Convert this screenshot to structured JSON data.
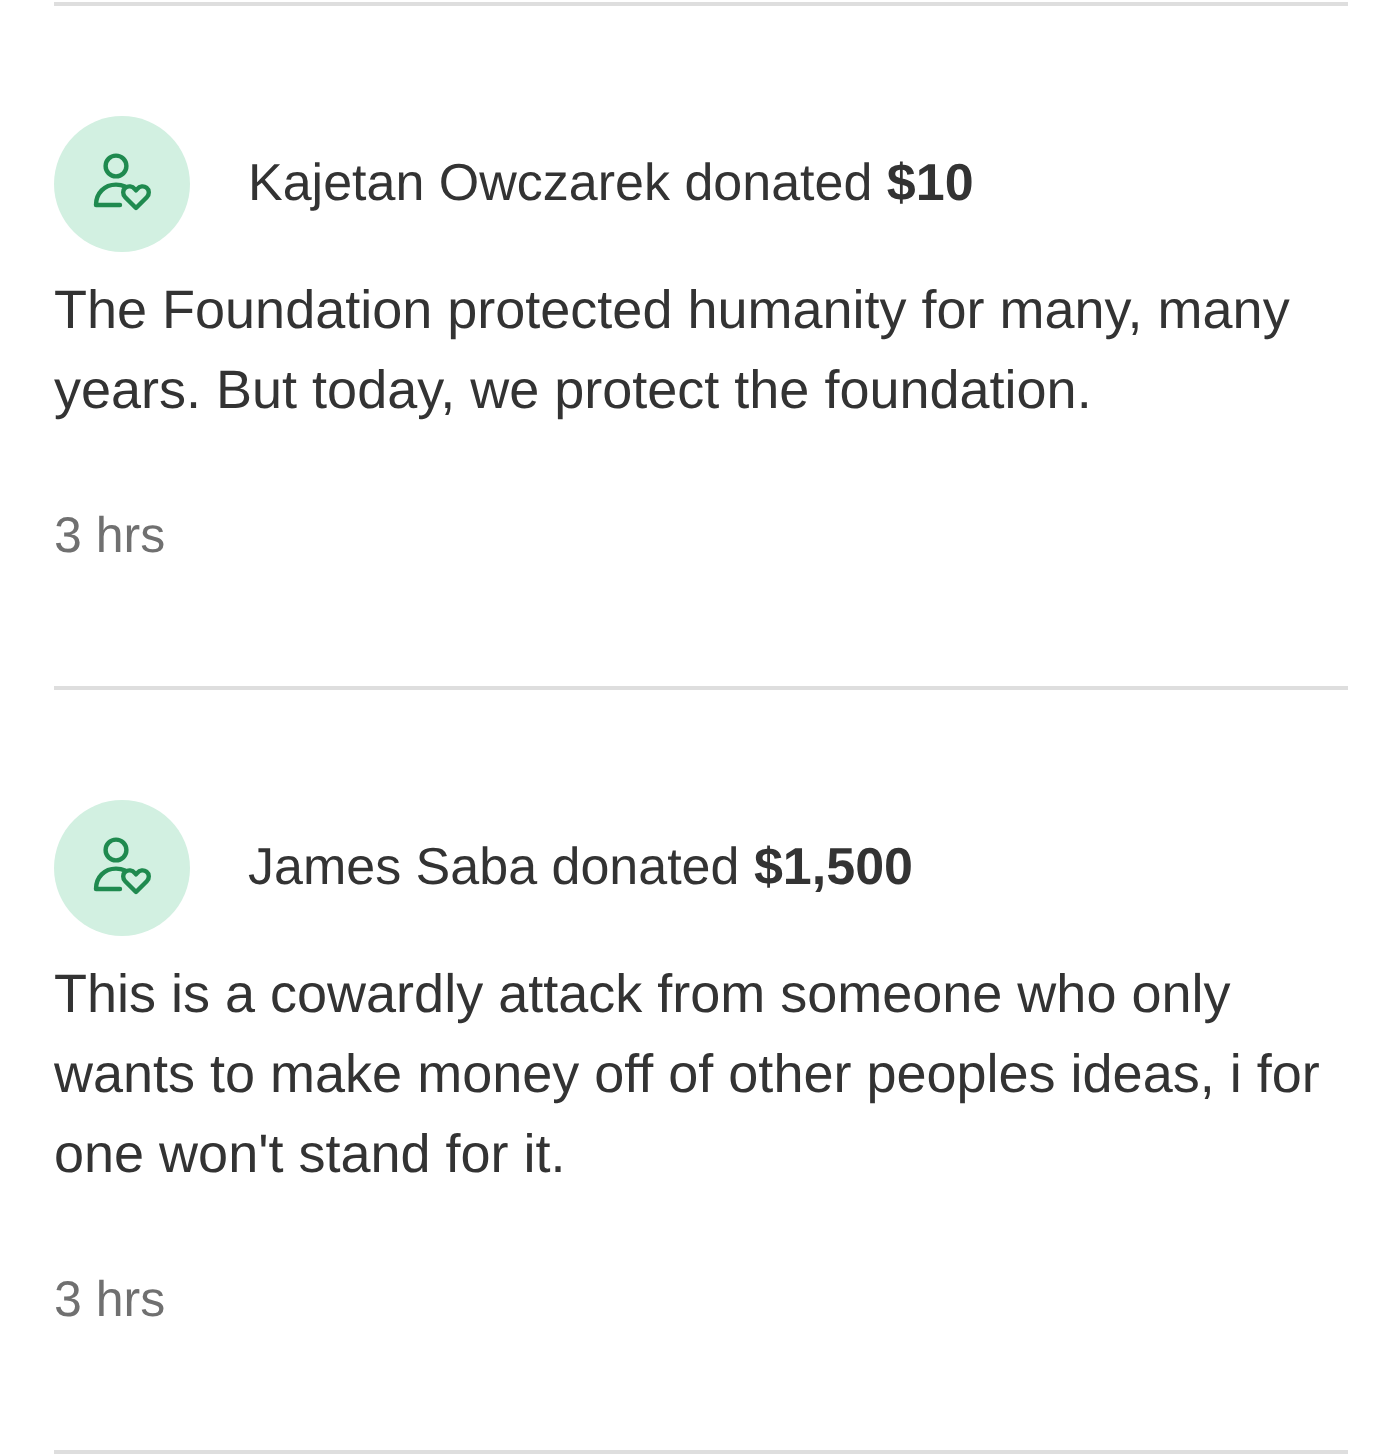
{
  "donations": [
    {
      "headline": "Kajetan Owczarek donated **$10**",
      "comment": "The Foundation protected humanity for many, many years. But today, we protect the foundation.",
      "time": "3 hrs"
    },
    {
      "headline": "James Saba donated **$1,500**",
      "comment": "This is a cowardly attack from someone who only wants to make money off of other peoples ideas, i for one won't stand for it.",
      "time": "3 hrs"
    }
  ]
}
